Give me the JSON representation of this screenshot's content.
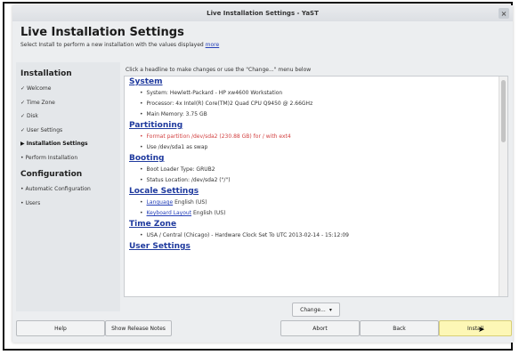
{
  "window": {
    "title": "Live Installation Settings - YaST",
    "close_icon": "×"
  },
  "header": {
    "title": "Live Installation Settings",
    "subtitle": "Select Install to perform a new installation with the values displayed",
    "more_link": "more"
  },
  "sidebar": {
    "groups": [
      {
        "label": "Installation",
        "items": [
          {
            "prefix": "✓",
            "label": "Welcome"
          },
          {
            "prefix": "✓",
            "label": "Time Zone"
          },
          {
            "prefix": "✓",
            "label": "Disk"
          },
          {
            "prefix": "✓",
            "label": "User Settings"
          },
          {
            "prefix": "▶",
            "label": "Installation Settings"
          },
          {
            "prefix": "•",
            "label": "Perform Installation"
          }
        ]
      },
      {
        "label": "Configuration",
        "items": [
          {
            "prefix": "•",
            "label": "Automatic Configuration"
          },
          {
            "prefix": "•",
            "label": "Users"
          }
        ]
      }
    ]
  },
  "content": {
    "hint": "Click a headline to make changes or use the \"Change...\" menu below",
    "sections": {
      "system": {
        "title": "System",
        "items": [
          "System: Hewlett-Packard - HP xw4600 Workstation",
          "Processor: 4x Intel(R) Core(TM)2 Quad CPU Q9450 @ 2.66GHz",
          "Main Memory: 3.75 GB"
        ]
      },
      "partitioning": {
        "title": "Partitioning",
        "items": [
          "Format partition /dev/sda2 (230.88 GB) for / with ext4",
          "Use /dev/sda1 as swap"
        ]
      },
      "booting": {
        "title": "Booting",
        "items": [
          "Boot Loader Type: GRUB2",
          "Status Location: /dev/sda2 (\"/\")"
        ]
      },
      "locale": {
        "title": "Locale Settings",
        "language_link": "Language",
        "language_value": "English (US)",
        "keyboard_link": "Keyboard Layout",
        "keyboard_value": "English (US)"
      },
      "timezone": {
        "title": "Time Zone",
        "items": [
          "USA / Central (Chicago) - Hardware Clock Set To UTC 2013-02-14 - 15:12:09"
        ]
      },
      "users": {
        "title": "User Settings"
      }
    }
  },
  "buttons": {
    "change": "Change...",
    "change_arrow": "▾",
    "help": "Help",
    "release_notes": "Show Release Notes",
    "abort": "Abort",
    "back": "Back",
    "install": "Install"
  }
}
